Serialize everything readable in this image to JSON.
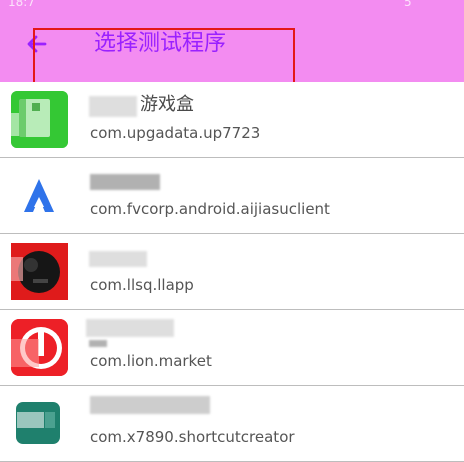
{
  "status_bar": {
    "left_fragment": "18:7",
    "right_fragment": "5"
  },
  "app_bar": {
    "title": "选择测试程序"
  },
  "apps": [
    {
      "name_visible_part": "游戏盒",
      "package": "com.upgadata.up7723",
      "icon_name": "app-icon-green"
    },
    {
      "name_visible_part": "",
      "package": "com.fvcorp.android.aijiasuclient",
      "icon_name": "rocket-icon"
    },
    {
      "name_visible_part": "",
      "package": "com.llsq.llapp",
      "icon_name": "app-icon-red-black"
    },
    {
      "name_visible_part": "",
      "package": "com.lion.market",
      "icon_name": "app-icon-red-white"
    },
    {
      "name_visible_part": "",
      "package": "com.x7890.shortcutcreator",
      "icon_name": "app-icon-teal"
    }
  ],
  "colors": {
    "app_bar": "#f38cf1",
    "title": "#9a21ff",
    "highlight": "#e41717"
  }
}
